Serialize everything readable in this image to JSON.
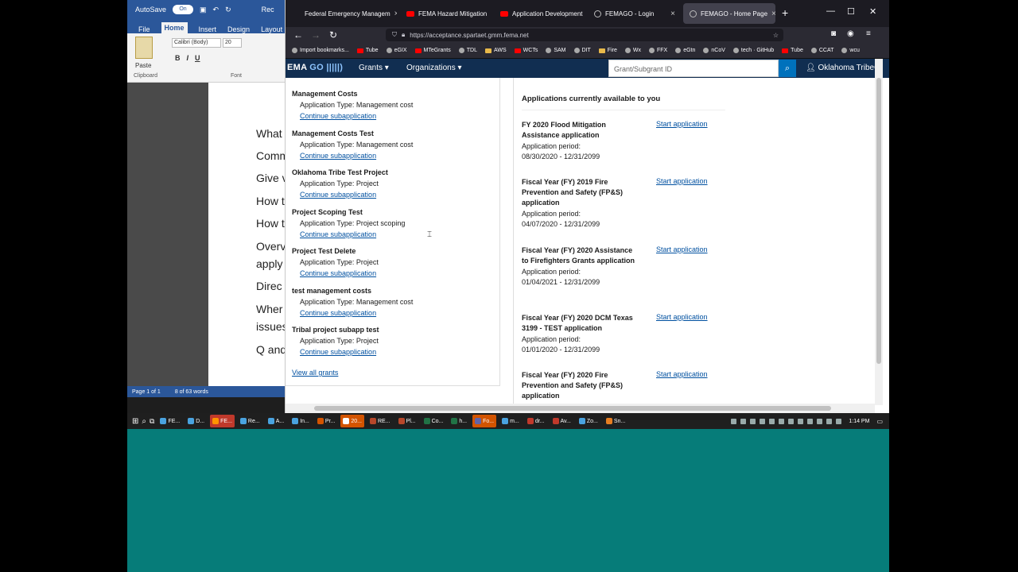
{
  "word": {
    "autosave": "AutoSave",
    "autosave_state": "On",
    "title_frag": "Rec",
    "menu": [
      "File",
      "Home",
      "Insert",
      "Design",
      "Layout"
    ],
    "font": "Calibri (Body)",
    "size": "20",
    "paste": "Paste",
    "clipboard_label": "Clipboard",
    "font_label": "Font",
    "doc_lines": [
      "What",
      "Comm",
      "Give v",
      "How t",
      "How t",
      "Overv",
      "apply",
      "Direc",
      "Wher",
      "issues",
      "Q and"
    ],
    "status_page": "Page 1 of 1",
    "status_words": "8 of 63 words"
  },
  "browser": {
    "tabs": [
      {
        "label": "Federal Emergency Managem",
        "icon": "none"
      },
      {
        "label": "FEMA Hazard Mitigation",
        "icon": "youtube"
      },
      {
        "label": "Application Development",
        "icon": "youtube"
      },
      {
        "label": "FEMAGO - Login",
        "icon": "globe"
      },
      {
        "label": "FEMAGO - Home Page",
        "icon": "globe"
      }
    ],
    "url": "https://acceptance.spartaet.gmm.fema.net",
    "bookmarks": [
      "Import bookmarks...",
      "Tube",
      "eGIX",
      "MTeGrants",
      "TDL",
      "AWS",
      "WCTs",
      "SAM",
      "DIT",
      "Fire",
      "Wx",
      "FFX",
      "eGtn",
      "nCoV",
      "tech · GitHub",
      "Tube",
      "CCAT",
      "wcu"
    ]
  },
  "fema": {
    "logo_prefix": "EMA",
    "logo_go": "GO",
    "nav": [
      "Grants",
      "Organizations"
    ],
    "search_placeholder": "Grant/Subgrant ID",
    "user": "Oklahoma TribeO"
  },
  "subapplications": [
    {
      "title": "Management Costs",
      "type": "Application Type: Management cost",
      "link": "Continue subapplication"
    },
    {
      "title": "Management Costs Test",
      "type": "Application Type: Management cost",
      "link": "Continue subapplication"
    },
    {
      "title": "Oklahoma Tribe Test Project",
      "type": "Application Type: Project",
      "link": "Continue subapplication"
    },
    {
      "title": "Project Scoping Test",
      "type": "Application Type: Project scoping",
      "link": "Continue subapplication"
    },
    {
      "title": "Project Test Delete",
      "type": "Application Type: Project",
      "link": "Continue subapplication"
    },
    {
      "title": "test management costs",
      "type": "Application Type: Management cost",
      "link": "Continue subapplication"
    },
    {
      "title": "Tribal project subapp test",
      "type": "Application Type: Project",
      "link": "Continue subapplication"
    }
  ],
  "view_all": "View all grants",
  "available": {
    "heading": "Applications currently available to you",
    "items": [
      {
        "name": "FY 2020 Flood Mitigation Assistance application",
        "period_label": "Application period:",
        "period": "08/30/2020 - 12/31/2099",
        "action": "Start application"
      },
      {
        "name": "Fiscal Year (FY) 2019 Fire Prevention and Safety (FP&S) application",
        "period_label": "Application period:",
        "period": "04/07/2020 - 12/31/2099",
        "action": "Start application"
      },
      {
        "name": "Fiscal Year (FY) 2020 Assistance to Firefighters Grants application",
        "period_label": "Application period:",
        "period": "01/04/2021 - 12/31/2099",
        "action": "Start application"
      },
      {
        "name": "Fiscal Year (FY) 2020 DCM Texas 3199 - TEST application",
        "period_label": "Application period:",
        "period": "01/01/2020 - 12/31/2099",
        "action": "Start application"
      },
      {
        "name": "Fiscal Year (FY) 2020 Fire Prevention and Safety (FP&S) application",
        "period_label": "",
        "period": "",
        "action": "Start application"
      }
    ]
  },
  "taskbar": {
    "items": [
      "FE...",
      "D...",
      "FE...",
      "Re...",
      "A...",
      "In...",
      "Pr...",
      "20...",
      "RE...",
      "Pl...",
      "Co...",
      "h...",
      "Fo...",
      "m...",
      "dr...",
      "Av...",
      "Zo...",
      "Sn..."
    ],
    "time": "1:14 PM"
  }
}
